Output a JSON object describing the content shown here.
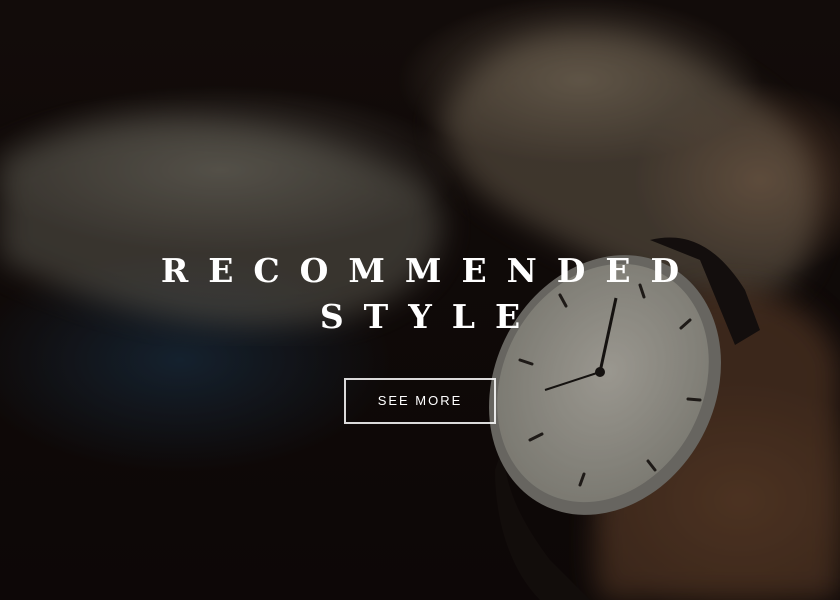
{
  "hero": {
    "headline_line1": "RECOMMENDED",
    "headline_line2": "STYLE",
    "cta_label": "SEE MORE"
  },
  "colors": {
    "text": "#ffffff",
    "button_border": "#ffffff"
  }
}
